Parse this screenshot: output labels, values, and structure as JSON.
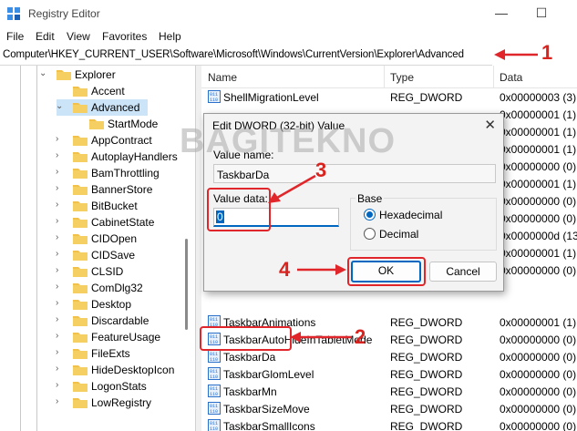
{
  "window": {
    "title": "Registry Editor",
    "minimize": "—",
    "maximize": "☐"
  },
  "menu": [
    "File",
    "Edit",
    "View",
    "Favorites",
    "Help"
  ],
  "address": "Computer\\HKEY_CURRENT_USER\\Software\\Microsoft\\Windows\\CurrentVersion\\Explorer\\Advanced",
  "tree": [
    {
      "label": "Explorer",
      "expanded": true
    },
    {
      "label": "Accent"
    },
    {
      "label": "Advanced",
      "expanded": true,
      "selected": true
    },
    {
      "label": "StartMode"
    },
    {
      "label": "AppContract"
    },
    {
      "label": "AutoplayHandlers"
    },
    {
      "label": "BamThrottling"
    },
    {
      "label": "BannerStore"
    },
    {
      "label": "BitBucket"
    },
    {
      "label": "CabinetState"
    },
    {
      "label": "CIDOpen"
    },
    {
      "label": "CIDSave"
    },
    {
      "label": "CLSID"
    },
    {
      "label": "ComDlg32"
    },
    {
      "label": "Desktop"
    },
    {
      "label": "Discardable"
    },
    {
      "label": "FeatureUsage"
    },
    {
      "label": "FileExts"
    },
    {
      "label": "HideDesktopIcon"
    },
    {
      "label": "LogonStats"
    },
    {
      "label": "LowRegistry"
    }
  ],
  "columns": {
    "name": "Name",
    "type": "Type",
    "data": "Data"
  },
  "values": [
    {
      "name": "ShellMigrationLevel",
      "type": "REG_DWORD",
      "data": "0x00000003 (3)"
    },
    {
      "name": "",
      "type": "",
      "data": "0x00000001 (1)"
    },
    {
      "name": "",
      "type": "",
      "data": "0x00000001 (1)"
    },
    {
      "name": "",
      "type": "",
      "data": "0x00000001 (1)"
    },
    {
      "name": "",
      "type": "",
      "data": "0x00000000 (0)"
    },
    {
      "name": "",
      "type": "",
      "data": "0x00000001 (1)"
    },
    {
      "name": "",
      "type": "",
      "data": "0x00000000 (0)"
    },
    {
      "name": "",
      "type": "",
      "data": "0x00000000 (0)"
    },
    {
      "name": "",
      "type": "",
      "data": "0x0000000d (13)"
    },
    {
      "name": "",
      "type": "",
      "data": "0x00000001 (1)"
    },
    {
      "name": "",
      "type": "",
      "data": "0x00000000 (0)"
    },
    {
      "name": "",
      "type": "",
      "data": ""
    },
    {
      "name": "",
      "type": "",
      "data": ""
    },
    {
      "name": "TaskbarAnimations",
      "type": "REG_DWORD",
      "data": "0x00000001 (1)"
    },
    {
      "name": "TaskbarAutoHideInTabletMode",
      "type": "REG_DWORD",
      "data": "0x00000000 (0)"
    },
    {
      "name": "TaskbarDa",
      "type": "REG_DWORD",
      "data": "0x00000000 (0)"
    },
    {
      "name": "TaskbarGlomLevel",
      "type": "REG_DWORD",
      "data": "0x00000000 (0)"
    },
    {
      "name": "TaskbarMn",
      "type": "REG_DWORD",
      "data": "0x00000000 (0)"
    },
    {
      "name": "TaskbarSizeMove",
      "type": "REG_DWORD",
      "data": "0x00000000 (0)"
    },
    {
      "name": "TaskbarSmallIcons",
      "type": "REG_DWORD",
      "data": "0x00000000 (0)"
    }
  ],
  "dialog": {
    "title": "Edit DWORD (32-bit) Value",
    "close": "✕",
    "value_name_label": "Value name:",
    "value_name": "TaskbarDa",
    "value_data_label": "Value data:",
    "value_data": "0",
    "base_label": "Base",
    "hex_label": "Hexadecimal",
    "dec_label": "Decimal",
    "ok": "OK",
    "cancel": "Cancel"
  },
  "annotations": {
    "n1": "1",
    "n2": "2",
    "n3": "3",
    "n4": "4"
  },
  "watermark": "BAGITEKNO",
  "colors": {
    "accent": "#0067c0",
    "annotation": "#e0262a",
    "folder": "#f1c14a"
  }
}
